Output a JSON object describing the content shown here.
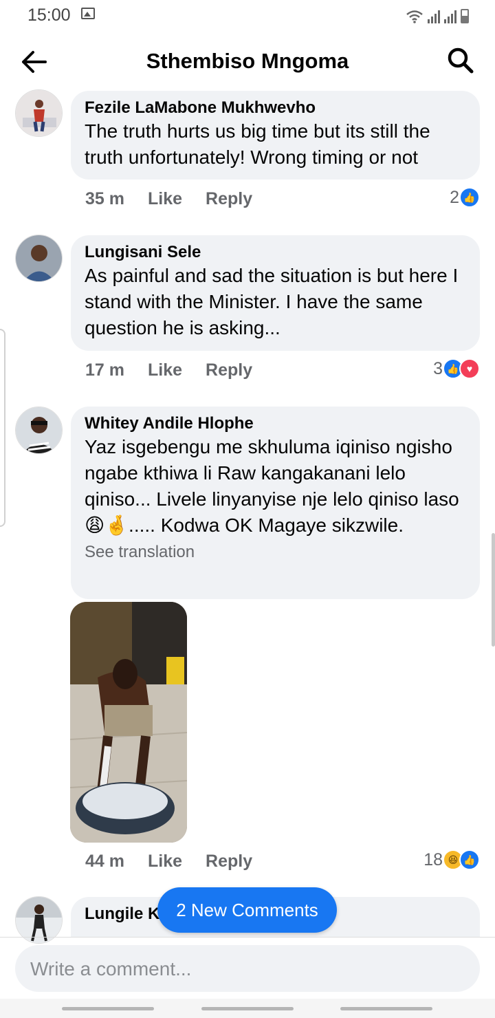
{
  "status_bar": {
    "time": "15:00"
  },
  "header": {
    "title": "Sthembiso Mngoma"
  },
  "comments": [
    {
      "author": "Fezile LaMabone Mukhwevho",
      "text": "The truth hurts us big time but its still the truth unfortunately! Wrong timing or not",
      "time": "35 m",
      "like_label": "Like",
      "reply_label": "Reply",
      "reaction_count": "2",
      "reactions": [
        "like-icon"
      ]
    },
    {
      "author": "Lungisani Sele",
      "text": "As painful and sad the situation is but here I stand with the Minister. I have the same question he is asking...",
      "time": "17 m",
      "like_label": "Like",
      "reply_label": "Reply",
      "reaction_count": "3",
      "reactions": [
        "like-icon",
        "love-icon"
      ]
    },
    {
      "author": "Whitey Andile Hlophe",
      "text": "Yaz isgebengu me skhuluma iqiniso ngisho ngabe kthiwa li Raw kangakanani lelo qiniso... Livele linyanyise nje lelo qiniso laso😩🤞..... Kodwa OK Magaye sikzwile.",
      "see_translation": "See translation",
      "time": "44 m",
      "like_label": "Like",
      "reply_label": "Reply",
      "reaction_count": "18",
      "reactions": [
        "haha-icon",
        "like-icon"
      ]
    },
    {
      "author": "Lungile K"
    }
  ],
  "new_comments_pill": "2 New Comments",
  "composer": {
    "placeholder": "Write a comment..."
  },
  "colors": {
    "accent": "#1877f2",
    "bubble": "#f0f2f5",
    "love": "#f33e58",
    "haha": "#f7b928"
  }
}
